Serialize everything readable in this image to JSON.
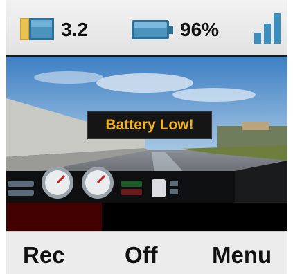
{
  "status_bar": {
    "storage_value": "3.2",
    "battery_percent": "96%",
    "storage_icon": "sd-card-icon",
    "battery_icon": "battery-icon",
    "signal_icon": "signal-strength-icon",
    "signal_level": 3,
    "signal_max": 3
  },
  "viewport": {
    "alert_text": "Battery Low!",
    "progress_fraction": 0.34,
    "progress_color": "#430000"
  },
  "softkeys": {
    "left_label": "Rec",
    "center_label": "Off",
    "right_label": "Menu"
  },
  "colors": {
    "alert_text": "#f3b21b",
    "icon_blue": "#3a7fa8",
    "signal_blue": "#3b8fbf"
  }
}
